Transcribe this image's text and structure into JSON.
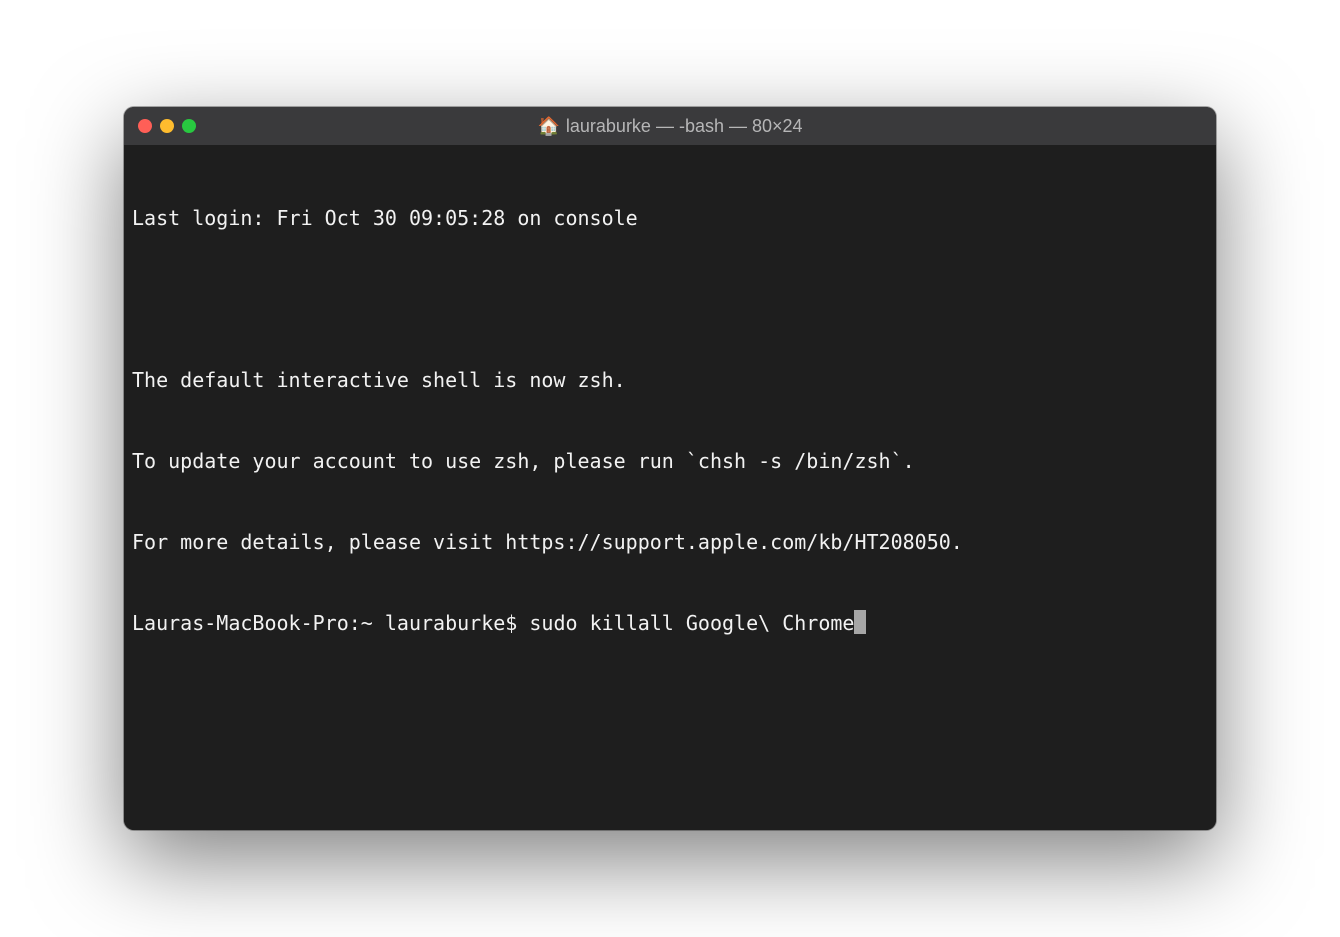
{
  "window": {
    "title": "lauraburke — -bash — 80×24",
    "icon": "🏠"
  },
  "terminal": {
    "lines": {
      "last_login": "Last login: Fri Oct 30 09:05:28 on console",
      "shell_notice_1": "The default interactive shell is now zsh.",
      "shell_notice_2": "To update your account to use zsh, please run `chsh -s /bin/zsh`.",
      "shell_notice_3": "For more details, please visit https://support.apple.com/kb/HT208050."
    },
    "prompt": "Lauras-MacBook-Pro:~ lauraburke$ ",
    "command": "sudo killall Google\\ Chrome"
  }
}
